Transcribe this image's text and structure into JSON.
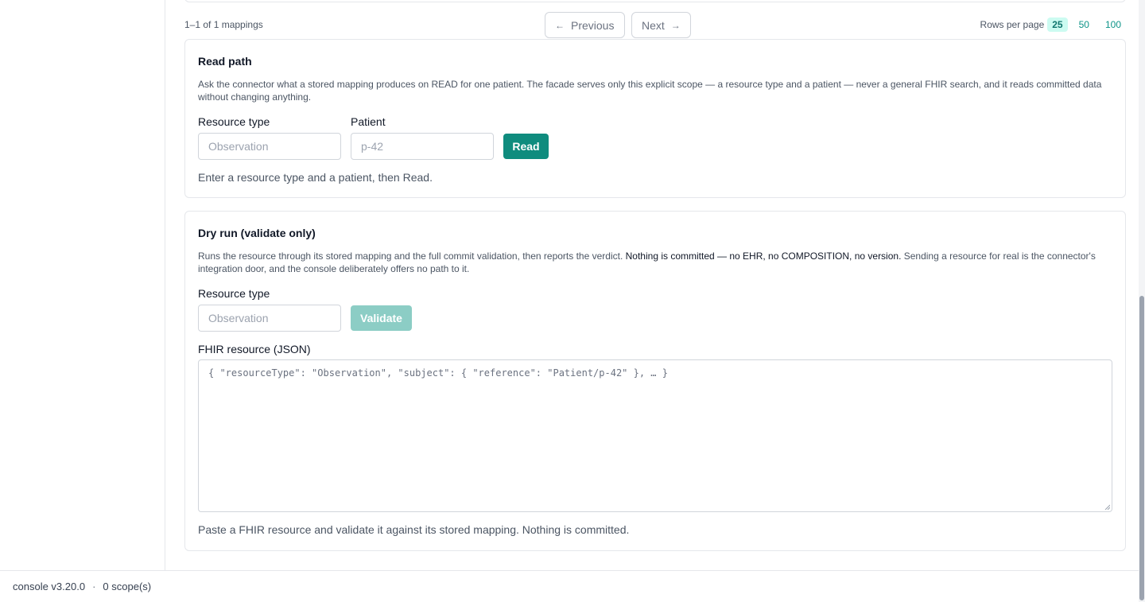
{
  "pager": {
    "count_text": "1–1 of 1 mappings",
    "previous_label": "Previous",
    "next_label": "Next",
    "rows_label": "Rows per page",
    "rows_options": [
      "25",
      "50",
      "100"
    ],
    "rows_selected": "25"
  },
  "read_path": {
    "title": "Read path",
    "description": "Ask the connector what a stored mapping produces on READ for one patient. The facade serves only this explicit scope — a resource type and a patient — never a general FHIR search, and it reads committed data without changing anything.",
    "resource_type_label": "Resource type",
    "resource_type_placeholder": "Observation",
    "patient_label": "Patient",
    "patient_placeholder": "p-42",
    "read_button": "Read",
    "hint": "Enter a resource type and a patient, then Read."
  },
  "dry_run": {
    "title": "Dry run (validate only)",
    "description_before": "Runs the resource through its stored mapping and the full commit validation, then reports the verdict. ",
    "description_strong": "Nothing is committed — no EHR, no COMPOSITION, no version.",
    "description_after": " Sending a resource for real is the connector's integration door, and the console deliberately offers no path to it.",
    "resource_type_label": "Resource type",
    "resource_type_placeholder": "Observation",
    "validate_button": "Validate",
    "json_label": "FHIR resource (JSON)",
    "json_placeholder": "{ \"resourceType\": \"Observation\", \"subject\": { \"reference\": \"Patient/p-42\" }, … }",
    "hint": "Paste a FHIR resource and validate it against its stored mapping. Nothing is committed."
  },
  "footer": {
    "version": "console v3.20.0",
    "separator": "·",
    "scopes": "0 scope(s)"
  },
  "colors": {
    "accent": "#0f8c7e",
    "accent_disabled": "#8ccdc5",
    "rows_selected_bg": "#ccfbf1"
  }
}
